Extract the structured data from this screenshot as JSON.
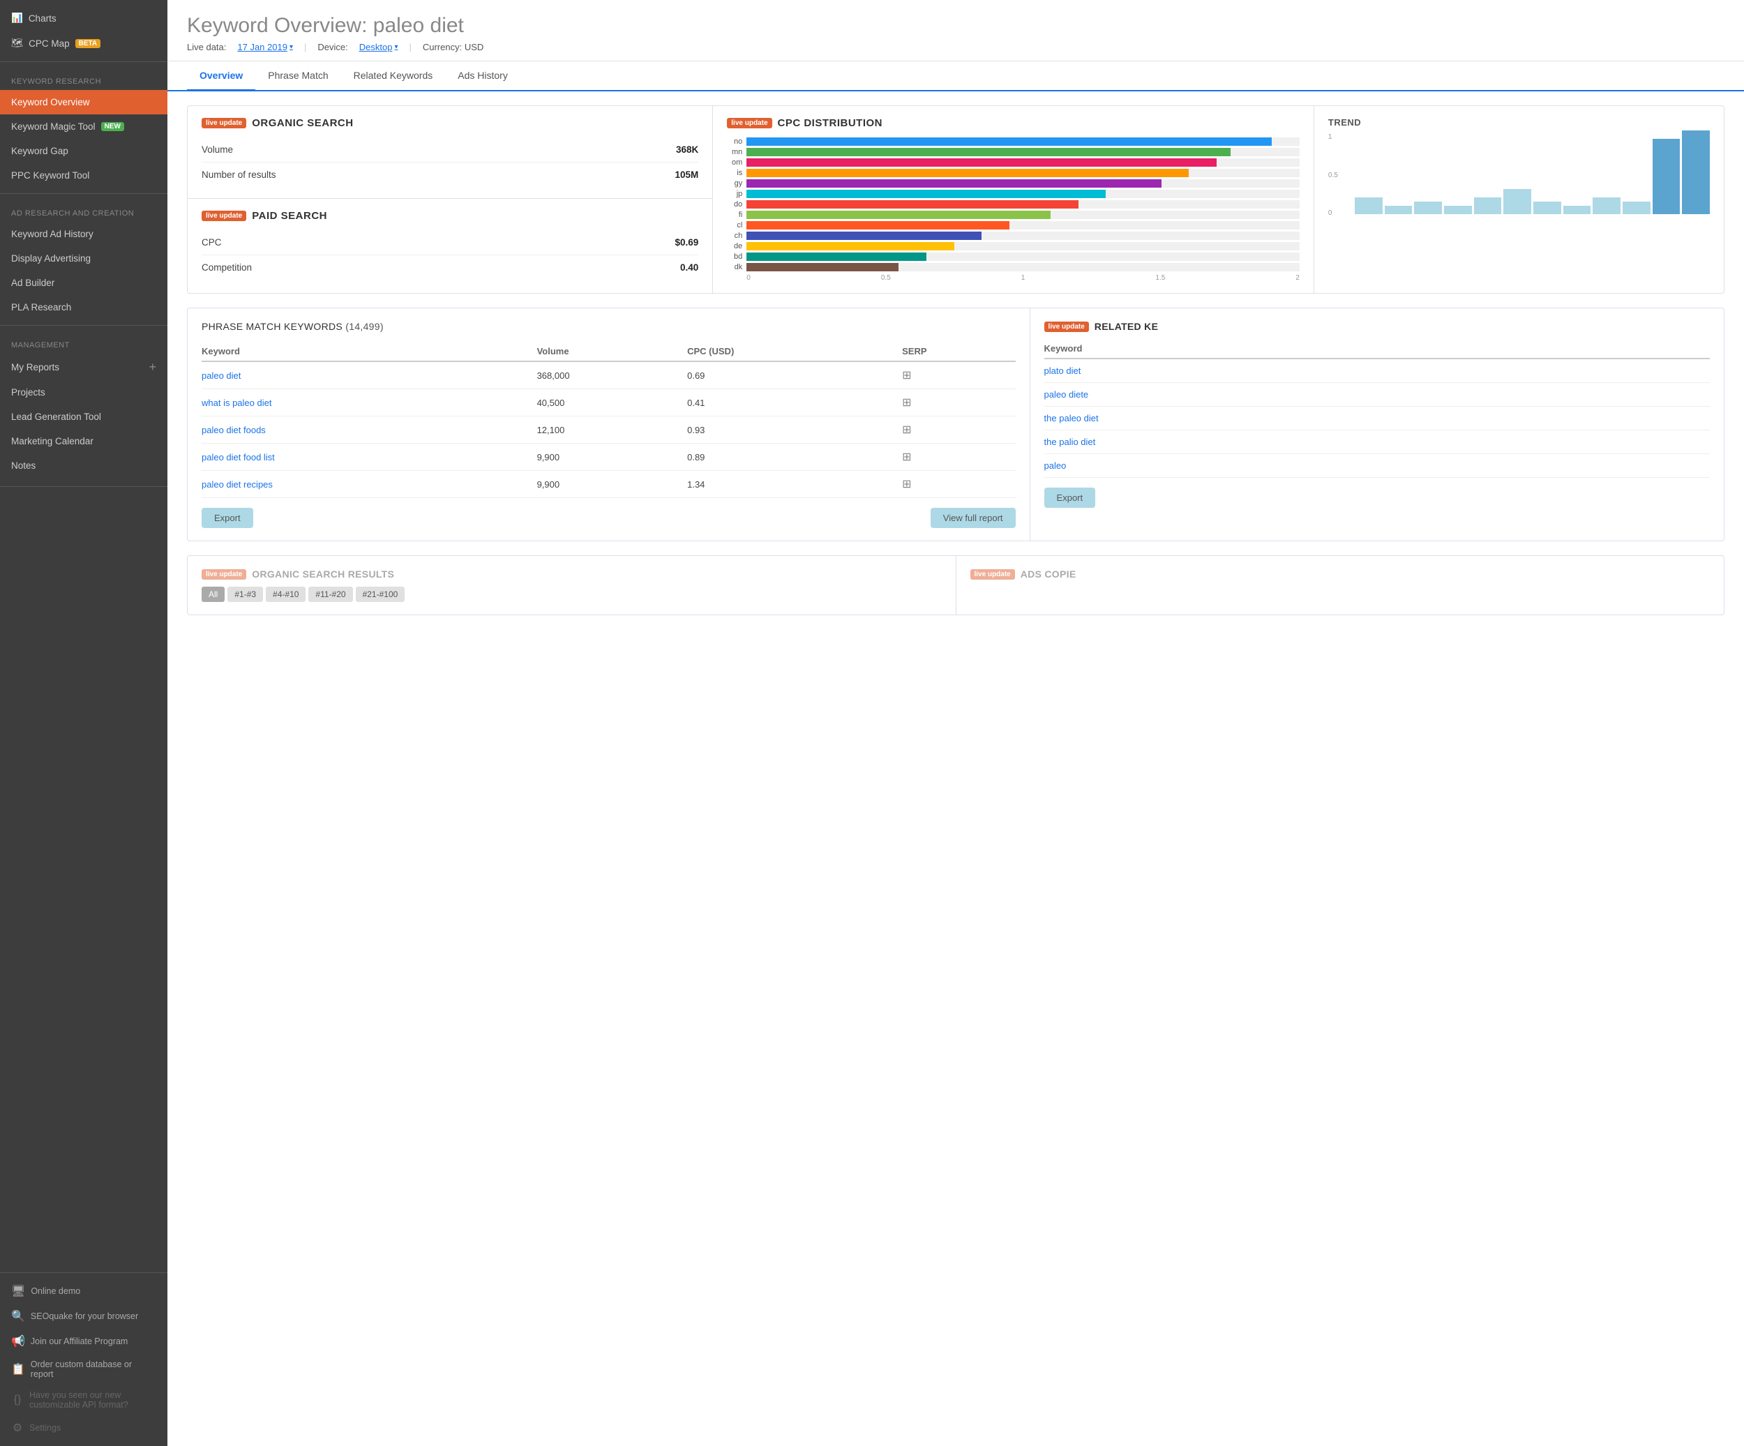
{
  "sidebar": {
    "items_top": [
      {
        "label": "Charts",
        "icon": "📊",
        "active": false
      },
      {
        "label": "CPC Map",
        "icon": "🗺",
        "active": false,
        "badge": "BETA"
      }
    ],
    "sections": [
      {
        "label": "KEYWORD RESEARCH",
        "items": [
          {
            "label": "Keyword Overview",
            "active": true
          },
          {
            "label": "Keyword Magic Tool",
            "badge": "NEW"
          },
          {
            "label": "Keyword Gap"
          },
          {
            "label": "PPC Keyword Tool"
          }
        ]
      },
      {
        "label": "AD RESEARCH AND CREATION",
        "items": [
          {
            "label": "Keyword Ad History"
          },
          {
            "label": "Display Advertising"
          },
          {
            "label": "Ad Builder"
          },
          {
            "label": "PLA Research"
          }
        ]
      },
      {
        "label": "MANAGEMENT",
        "items": [
          {
            "label": "My Reports",
            "has_plus": true
          },
          {
            "label": "Projects"
          },
          {
            "label": "Lead Generation Tool"
          },
          {
            "label": "Marketing Calendar"
          },
          {
            "label": "Notes"
          }
        ]
      }
    ],
    "footer": [
      {
        "label": "Online demo",
        "icon": "🖥"
      },
      {
        "label": "SEOquake for your browser",
        "icon": "🔍"
      },
      {
        "label": "Join our Affiliate Program",
        "icon": "📢"
      },
      {
        "label": "Order custom database or report",
        "icon": "📋"
      },
      {
        "label": "Have you seen our new customizable API format?",
        "icon": "{}",
        "dimmed": true
      },
      {
        "label": "Settings",
        "icon": "⚙",
        "dimmed": true
      }
    ]
  },
  "page": {
    "title": "Keyword Overview:",
    "keyword": "paleo diet",
    "meta": {
      "live_data_label": "Live data:",
      "date": "17 Jan 2019",
      "device_label": "Device:",
      "device": "Desktop",
      "currency": "Currency: USD"
    }
  },
  "tabs": [
    {
      "label": "Overview",
      "active": true
    },
    {
      "label": "Phrase Match",
      "active": false
    },
    {
      "label": "Related Keywords",
      "active": false
    },
    {
      "label": "Ads History",
      "active": false
    }
  ],
  "organic_search": {
    "badge": "live update",
    "title": "ORGANIC SEARCH",
    "rows": [
      {
        "label": "Volume",
        "value": "368K"
      },
      {
        "label": "Number of results",
        "value": "105M"
      }
    ]
  },
  "paid_search": {
    "badge": "live update",
    "title": "PAID SEARCH",
    "rows": [
      {
        "label": "CPC",
        "value": "$0.69"
      },
      {
        "label": "Competition",
        "value": "0.40"
      }
    ]
  },
  "cpc_distribution": {
    "badge": "live update",
    "title": "CPC DISTRIBUTION",
    "bars": [
      {
        "label": "no",
        "value": 1.9,
        "color": "#2196f3"
      },
      {
        "label": "mn",
        "value": 1.75,
        "color": "#4caf50"
      },
      {
        "label": "om",
        "value": 1.7,
        "color": "#e91e63"
      },
      {
        "label": "is",
        "value": 1.6,
        "color": "#ff9800"
      },
      {
        "label": "gy",
        "value": 1.5,
        "color": "#9c27b0"
      },
      {
        "label": "jp",
        "value": 1.3,
        "color": "#00bcd4"
      },
      {
        "label": "do",
        "value": 1.2,
        "color": "#f44336"
      },
      {
        "label": "fi",
        "value": 1.1,
        "color": "#8bc34a"
      },
      {
        "label": "cl",
        "value": 0.95,
        "color": "#ff5722"
      },
      {
        "label": "ch",
        "value": 0.85,
        "color": "#3f51b5"
      },
      {
        "label": "de",
        "value": 0.75,
        "color": "#ffc107"
      },
      {
        "label": "bd",
        "value": 0.65,
        "color": "#009688"
      },
      {
        "label": "dk",
        "value": 0.55,
        "color": "#795548"
      }
    ],
    "axis": [
      "0",
      "0.5",
      "1",
      "1.5",
      "2"
    ]
  },
  "trend": {
    "title": "TREND",
    "y_labels": [
      "1",
      "0.5",
      "0"
    ],
    "bars": [
      0.2,
      0.1,
      0.15,
      0.1,
      0.2,
      0.3,
      0.15,
      0.1,
      0.2,
      0.15,
      0.9,
      1.0
    ]
  },
  "phrase_match": {
    "title": "PHRASE MATCH KEYWORDS",
    "count": "(14,499)",
    "columns": [
      "Keyword",
      "Volume",
      "CPC (USD)",
      "SERP"
    ],
    "rows": [
      {
        "keyword": "paleo diet",
        "volume": "368,000",
        "cpc": "0.69"
      },
      {
        "keyword": "what is paleo diet",
        "volume": "40,500",
        "cpc": "0.41"
      },
      {
        "keyword": "paleo diet foods",
        "volume": "12,100",
        "cpc": "0.93"
      },
      {
        "keyword": "paleo diet food list",
        "volume": "9,900",
        "cpc": "0.89"
      },
      {
        "keyword": "paleo diet recipes",
        "volume": "9,900",
        "cpc": "1.34"
      }
    ],
    "export_label": "Export",
    "view_full_label": "View full report"
  },
  "related_keywords": {
    "badge": "live update",
    "title": "RELATED KE",
    "columns": [
      "Keyword"
    ],
    "rows": [
      {
        "keyword": "plato diet"
      },
      {
        "keyword": "paleo diete"
      },
      {
        "keyword": "the paleo diet"
      },
      {
        "keyword": "the palio diet"
      },
      {
        "keyword": "paleo"
      }
    ],
    "export_label": "Export"
  },
  "organic_results": {
    "badge": "live update",
    "title": "ORGANIC SEARCH RESULTS",
    "filter_tabs": [
      "All",
      "#1-#3",
      "#4-#10",
      "#11-#20",
      "#21-#100"
    ]
  },
  "ads_copies": {
    "badge": "live update",
    "title": "ADS COPIE"
  }
}
